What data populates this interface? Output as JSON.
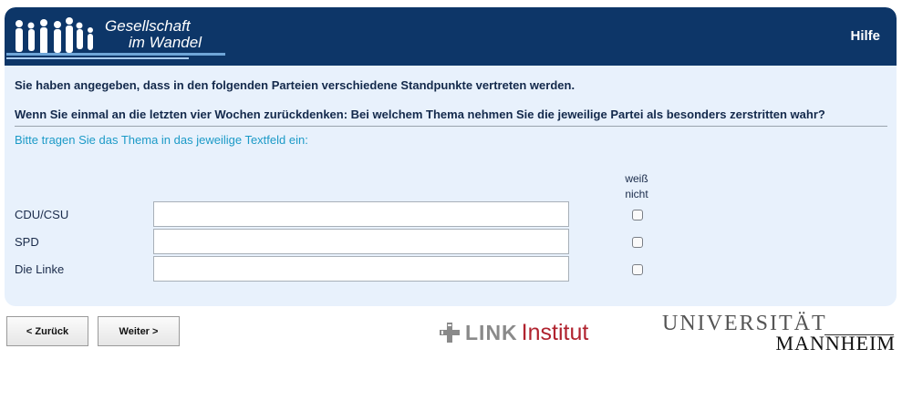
{
  "header": {
    "logo_line1": "Gesellschaft",
    "logo_line2": "im Wandel",
    "help_label": "Hilfe",
    "background": "#0d3668"
  },
  "survey": {
    "intro": "Sie haben angegeben, dass in den folgenden Parteien verschiedene Standpunkte vertreten werden.",
    "question": "Wenn Sie einmal an die letzten vier Wochen zurückdenken: Bei welchem Thema nehmen Sie die jeweilige Partei als besonders zerstritten wahr?",
    "instruction": "Bitte tragen Sie das Thema in das jeweilige Textfeld ein:",
    "dont_know_line1": "weiß",
    "dont_know_line2": "nicht",
    "rows": [
      {
        "label": "CDU/CSU",
        "value": "",
        "dont_know": false
      },
      {
        "label": "SPD",
        "value": "",
        "dont_know": false
      },
      {
        "label": "Die Linke",
        "value": "",
        "dont_know": false
      }
    ]
  },
  "nav": {
    "back_label": "< Zurück",
    "next_label": "Weiter >"
  },
  "footer": {
    "link_word": "LINK",
    "link_institut": "Institut",
    "uni_line1": "UNIVERSITÄT",
    "uni_line2": "MANNHEIM"
  },
  "colors": {
    "panel_bg": "#e8f1fc",
    "instruction": "#1c9ac7",
    "link_red": "#b0222e"
  }
}
